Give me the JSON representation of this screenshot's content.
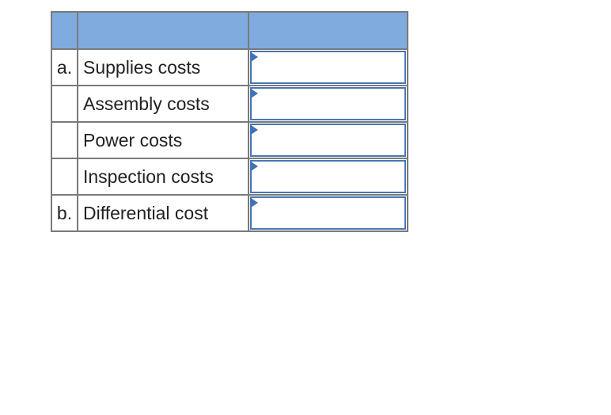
{
  "table": {
    "header": [
      "",
      "",
      ""
    ],
    "rows": [
      {
        "marker": "a.",
        "label": "Supplies costs",
        "value": ""
      },
      {
        "marker": "",
        "label": "Assembly costs",
        "value": ""
      },
      {
        "marker": "",
        "label": "Power costs",
        "value": ""
      },
      {
        "marker": "",
        "label": "Inspection costs",
        "value": ""
      },
      {
        "marker": "b.",
        "label": "Differential cost",
        "value": ""
      }
    ]
  },
  "colors": {
    "header_bg": "#80abdf",
    "input_border": "#4a76b5",
    "grid_border": "#7a7a7a"
  }
}
